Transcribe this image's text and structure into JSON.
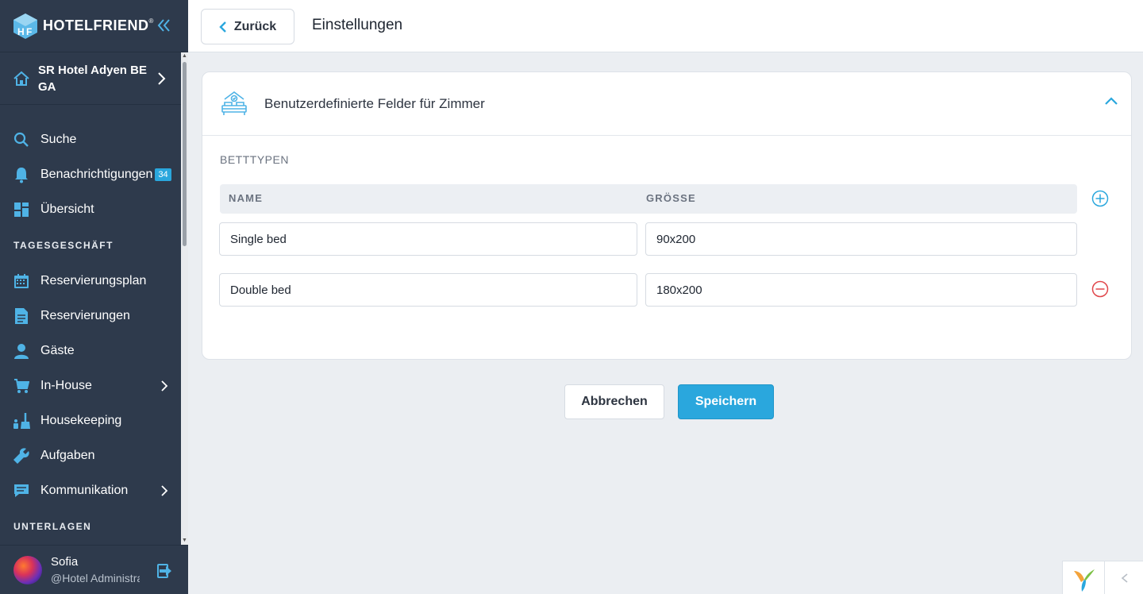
{
  "brand": {
    "name": "HOTELFRIEND",
    "reg": "®",
    "logo_icon": "hotelfriend-logo-icon",
    "collapse_icon": "double-chevron-left-icon"
  },
  "hotel": {
    "name": "SR Hotel Adyen BE GA",
    "icon": "home-icon"
  },
  "nav": {
    "search": "Suche",
    "notifications": "Benachrichtigungen",
    "notifications_count": "34",
    "overview": "Übersicht",
    "section_daily": "TAGESGESCHÄFT",
    "reservation_plan": "Reservierungsplan",
    "reservations": "Reservierungen",
    "guests": "Gäste",
    "inhouse": "In-House",
    "housekeeping": "Housekeeping",
    "tasks": "Aufgaben",
    "communication": "Kommunikation",
    "section_docs": "UNTERLAGEN"
  },
  "user": {
    "name": "Sofia",
    "role": "@Hotel Administrator"
  },
  "topbar": {
    "back_label": "Zurück",
    "title": "Einstellungen"
  },
  "card": {
    "title": "Benutzerdefinierte Felder für Zimmer",
    "section": "BETTTYPEN",
    "col_name": "NAME",
    "col_size": "GRÖSSE",
    "rows": [
      {
        "name": "Single bed",
        "size": "90x200"
      },
      {
        "name": "Double bed",
        "size": "180x200"
      }
    ]
  },
  "actions": {
    "cancel": "Abbrechen",
    "save": "Speichern"
  },
  "colors": {
    "sidebar": "#2e3a4c",
    "accent": "#2aa7dd",
    "danger": "#e0464a",
    "background": "#ebeef2"
  }
}
